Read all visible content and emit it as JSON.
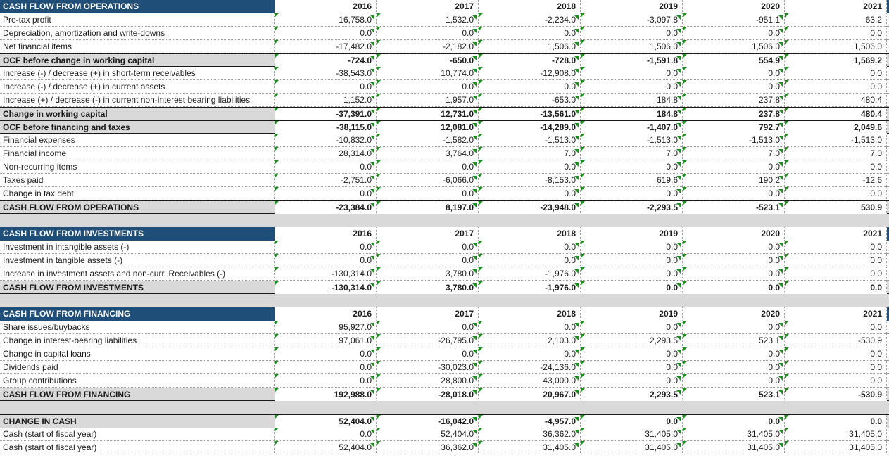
{
  "rows": [
    {
      "kind": "header",
      "label": "CASH FLOW FROM OPERATIONS",
      "values": [
        "2016",
        "2017",
        "2018",
        "2019",
        "2020",
        "2021"
      ]
    },
    {
      "kind": "data",
      "label": "Pre-tax profit",
      "values": [
        "16,758.0",
        "1,532.0",
        "-2,234.0",
        "-3,097.8",
        "-951.1",
        "63.2"
      ]
    },
    {
      "kind": "data",
      "label": "Depreciation, amortization and write-downs",
      "values": [
        "0.0",
        "0.0",
        "0.0",
        "0.0",
        "0.0",
        "0.0"
      ]
    },
    {
      "kind": "data",
      "label": "Net financial items",
      "values": [
        "-17,482.0",
        "-2,182.0",
        "1,506.0",
        "1,506.0",
        "1,506.0",
        "1,506.0"
      ]
    },
    {
      "kind": "sub",
      "label": "OCF before change in working capital",
      "values": [
        "-724.0",
        "-650.0",
        "-728.0",
        "-1,591.8",
        "554.9",
        "1,569.2"
      ]
    },
    {
      "kind": "data",
      "label": "Increase (-) / decrease (+) in short-term receivables",
      "values": [
        "-38,543.0",
        "10,774.0",
        "-12,908.0",
        "0.0",
        "0.0",
        "0.0"
      ]
    },
    {
      "kind": "data",
      "label": "Increase (-) / decrease (+) in current assets",
      "values": [
        "0.0",
        "0.0",
        "0.0",
        "0.0",
        "0.0",
        "0.0"
      ]
    },
    {
      "kind": "data",
      "label": "Increase (+) / decrease (-) in current non-interest bearing liabilities",
      "values": [
        "1,152.0",
        "1,957.0",
        "-653.0",
        "184.8",
        "237.8",
        "480.4"
      ]
    },
    {
      "kind": "sub",
      "label": "Change in working capital",
      "values": [
        "-37,391.0",
        "12,731.0",
        "-13,561.0",
        "184.8",
        "237.8",
        "480.4"
      ]
    },
    {
      "kind": "sub",
      "label": "OCF before financing and taxes",
      "values": [
        "-38,115.0",
        "12,081.0",
        "-14,289.0",
        "-1,407.0",
        "792.7",
        "2,049.6"
      ]
    },
    {
      "kind": "data",
      "label": "Financial expenses",
      "values": [
        "-10,832.0",
        "-1,582.0",
        "-1,513.0",
        "-1,513.0",
        "-1,513.0",
        "-1,513.0"
      ]
    },
    {
      "kind": "data",
      "label": "Financial income",
      "values": [
        "28,314.0",
        "3,764.0",
        "7.0",
        "7.0",
        "7.0",
        "7.0"
      ]
    },
    {
      "kind": "data",
      "label": "Non-recurring items",
      "values": [
        "0.0",
        "0.0",
        "0.0",
        "0.0",
        "0.0",
        "0.0"
      ]
    },
    {
      "kind": "data",
      "label": "Taxes paid",
      "values": [
        "-2,751.0",
        "-6,066.0",
        "-8,153.0",
        "619.6",
        "190.2",
        "-12.6"
      ]
    },
    {
      "kind": "data",
      "label": "Change in tax debt",
      "values": [
        "0.0",
        "0.0",
        "0.0",
        "0.0",
        "0.0",
        "0.0"
      ]
    },
    {
      "kind": "total",
      "label": "CASH FLOW FROM OPERATIONS",
      "values": [
        "-23,384.0",
        "8,197.0",
        "-23,948.0",
        "-2,293.5",
        "-523.1",
        "530.9"
      ]
    },
    {
      "kind": "gap"
    },
    {
      "kind": "header",
      "label": "CASH FLOW FROM INVESTMENTS",
      "values": [
        "2016",
        "2017",
        "2018",
        "2019",
        "2020",
        "2021"
      ]
    },
    {
      "kind": "data",
      "label": "Investment in intangible assets (-)",
      "values": [
        "0.0",
        "0.0",
        "0.0",
        "0.0",
        "0.0",
        "0.0"
      ]
    },
    {
      "kind": "data",
      "label": "Investment in tangible assets (-)",
      "values": [
        "0.0",
        "0.0",
        "0.0",
        "0.0",
        "0.0",
        "0.0"
      ]
    },
    {
      "kind": "data",
      "label": "Increase in investment assets and non-curr. Receivables (-)",
      "values": [
        "-130,314.0",
        "3,780.0",
        "-1,976.0",
        "0.0",
        "0.0",
        "0.0"
      ]
    },
    {
      "kind": "total",
      "label": "CASH FLOW FROM INVESTMENTS",
      "values": [
        "-130,314.0",
        "3,780.0",
        "-1,976.0",
        "0.0",
        "0.0",
        "0.0"
      ]
    },
    {
      "kind": "gap"
    },
    {
      "kind": "header",
      "label": "CASH FLOW FROM FINANCING",
      "values": [
        "2016",
        "2017",
        "2018",
        "2019",
        "2020",
        "2021"
      ]
    },
    {
      "kind": "data",
      "label": "Share issues/buybacks",
      "values": [
        "95,927.0",
        "0.0",
        "0.0",
        "0.0",
        "0.0",
        "0.0"
      ]
    },
    {
      "kind": "data",
      "label": "Change in interest-bearing liabilities",
      "values": [
        "97,061.0",
        "-26,795.0",
        "2,103.0",
        "2,293.5",
        "523.1",
        "-530.9"
      ]
    },
    {
      "kind": "data",
      "label": "Change in capital loans",
      "values": [
        "0.0",
        "0.0",
        "0.0",
        "0.0",
        "0.0",
        "0.0"
      ]
    },
    {
      "kind": "data",
      "label": "Dividends paid",
      "values": [
        "0.0",
        "-30,023.0",
        "-24,136.0",
        "0.0",
        "0.0",
        "0.0"
      ]
    },
    {
      "kind": "data",
      "label": "Group contributions",
      "values": [
        "0.0",
        "28,800.0",
        "43,000.0",
        "0.0",
        "0.0",
        "0.0"
      ]
    },
    {
      "kind": "total",
      "label": "CASH FLOW FROM FINANCING",
      "values": [
        "192,988.0",
        "-28,018.0",
        "20,967.0",
        "2,293.5",
        "523.1",
        "-530.9"
      ]
    },
    {
      "kind": "gap"
    },
    {
      "kind": "change",
      "label": "CHANGE IN CASH",
      "values": [
        "52,404.0",
        "-16,042.0",
        "-4,957.0",
        "0.0",
        "0.0",
        "0.0"
      ]
    },
    {
      "kind": "data",
      "label": "Cash (start of fiscal year)",
      "values": [
        "0.0",
        "52,404.0",
        "36,362.0",
        "31,405.0",
        "31,405.0",
        "31,405.0"
      ]
    },
    {
      "kind": "data",
      "label": "Cash (start of fiscal year)",
      "values": [
        "52,404.0",
        "36,362.0",
        "31,405.0",
        "31,405.0",
        "31,405.0",
        "31,405.0"
      ]
    }
  ],
  "colors": {
    "header_bg": "#1f4e78",
    "total_bg": "#d9d9d9",
    "error_flag": "#1e8e1e"
  }
}
